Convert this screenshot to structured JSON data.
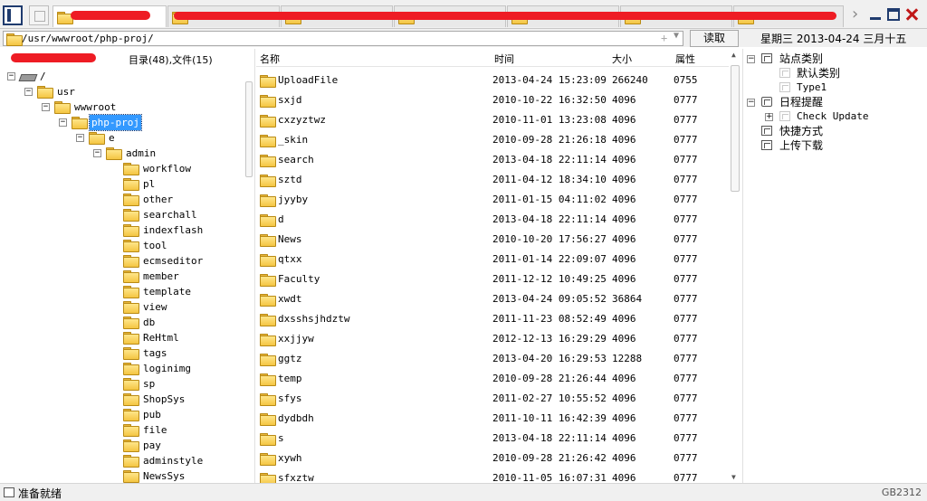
{
  "toolbar": {
    "panel_icon": "sidebar-toggle-icon",
    "home_icon": "window-icon"
  },
  "tabs": [
    {
      "active": true
    },
    {
      "active": false
    },
    {
      "active": false
    },
    {
      "active": false
    },
    {
      "active": false
    },
    {
      "active": false
    },
    {
      "active": false
    }
  ],
  "address": {
    "path": "/usr/wwwroot/php-proj/",
    "add_symbol": "+",
    "dropdown_symbol": "▼",
    "read_label": "读取",
    "date_text": "星期三 2013-04-24 三月十五"
  },
  "tree": {
    "summary": "目录(48),文件(15)",
    "nodes": [
      {
        "label": "/",
        "level": 0,
        "toggle": "−",
        "icon": "drive"
      },
      {
        "label": "usr",
        "level": 1,
        "toggle": "−",
        "icon": "folder"
      },
      {
        "label": "wwwroot",
        "level": 2,
        "toggle": "−",
        "icon": "folder"
      },
      {
        "label": "php-proj",
        "level": 3,
        "toggle": "−",
        "icon": "folder-open",
        "selected": true
      },
      {
        "label": "e",
        "level": 4,
        "toggle": "−",
        "icon": "folder"
      },
      {
        "label": "admin",
        "level": 5,
        "toggle": "−",
        "icon": "folder"
      },
      {
        "label": "workflow",
        "level": 6,
        "icon": "folder"
      },
      {
        "label": "pl",
        "level": 6,
        "icon": "folder"
      },
      {
        "label": "other",
        "level": 6,
        "icon": "folder"
      },
      {
        "label": "searchall",
        "level": 6,
        "icon": "folder"
      },
      {
        "label": "indexflash",
        "level": 6,
        "icon": "folder"
      },
      {
        "label": "tool",
        "level": 6,
        "icon": "folder"
      },
      {
        "label": "ecmseditor",
        "level": 6,
        "icon": "folder"
      },
      {
        "label": "member",
        "level": 6,
        "icon": "folder"
      },
      {
        "label": "template",
        "level": 6,
        "icon": "folder"
      },
      {
        "label": "view",
        "level": 6,
        "icon": "folder"
      },
      {
        "label": "db",
        "level": 6,
        "icon": "folder"
      },
      {
        "label": "ReHtml",
        "level": 6,
        "icon": "folder"
      },
      {
        "label": "tags",
        "level": 6,
        "icon": "folder"
      },
      {
        "label": "loginimg",
        "level": 6,
        "icon": "folder"
      },
      {
        "label": "sp",
        "level": 6,
        "icon": "folder"
      },
      {
        "label": "ShopSys",
        "level": 6,
        "icon": "folder"
      },
      {
        "label": "pub",
        "level": 6,
        "icon": "folder"
      },
      {
        "label": "file",
        "level": 6,
        "icon": "folder"
      },
      {
        "label": "pay",
        "level": 6,
        "icon": "folder"
      },
      {
        "label": "adminstyle",
        "level": 6,
        "icon": "folder"
      },
      {
        "label": "NewsSys",
        "level": 6,
        "icon": "folder"
      }
    ]
  },
  "file_list": {
    "columns": {
      "name": "名称",
      "time": "时间",
      "size": "大小",
      "attr": "属性"
    },
    "rows": [
      {
        "name": "UploadFile",
        "time": "2013-04-24 15:23:09",
        "size": "266240",
        "attr": "0755"
      },
      {
        "name": "sxjd",
        "time": "2010-10-22 16:32:50",
        "size": "4096",
        "attr": "0777"
      },
      {
        "name": "cxzyztwz",
        "time": "2010-11-01 13:23:08",
        "size": "4096",
        "attr": "0777"
      },
      {
        "name": "_skin",
        "time": "2010-09-28 21:26:18",
        "size": "4096",
        "attr": "0777"
      },
      {
        "name": "search",
        "time": "2013-04-18 22:11:14",
        "size": "4096",
        "attr": "0777"
      },
      {
        "name": "sztd",
        "time": "2011-04-12 18:34:10",
        "size": "4096",
        "attr": "0777"
      },
      {
        "name": "jyyby",
        "time": "2011-01-15 04:11:02",
        "size": "4096",
        "attr": "0777"
      },
      {
        "name": "d",
        "time": "2013-04-18 22:11:14",
        "size": "4096",
        "attr": "0777"
      },
      {
        "name": "News",
        "time": "2010-10-20 17:56:27",
        "size": "4096",
        "attr": "0777"
      },
      {
        "name": "qtxx",
        "time": "2011-01-14 22:09:07",
        "size": "4096",
        "attr": "0777"
      },
      {
        "name": "Faculty",
        "time": "2011-12-12 10:49:25",
        "size": "4096",
        "attr": "0777"
      },
      {
        "name": "xwdt",
        "time": "2013-04-24 09:05:52",
        "size": "36864",
        "attr": "0777"
      },
      {
        "name": "dxsshsjhdztw",
        "time": "2011-11-23 08:52:49",
        "size": "4096",
        "attr": "0777"
      },
      {
        "name": "xxjjyw",
        "time": "2012-12-13 16:29:29",
        "size": "4096",
        "attr": "0777"
      },
      {
        "name": "ggtz",
        "time": "2013-04-20 16:29:53",
        "size": "12288",
        "attr": "0777"
      },
      {
        "name": "temp",
        "time": "2010-09-28 21:26:44",
        "size": "4096",
        "attr": "0777"
      },
      {
        "name": "sfys",
        "time": "2011-02-27 10:55:52",
        "size": "4096",
        "attr": "0777"
      },
      {
        "name": "dydbdh",
        "time": "2011-10-11 16:42:39",
        "size": "4096",
        "attr": "0777"
      },
      {
        "name": "s",
        "time": "2013-04-18 22:11:14",
        "size": "4096",
        "attr": "0777"
      },
      {
        "name": "xywh",
        "time": "2010-09-28 21:26:42",
        "size": "4096",
        "attr": "0777"
      },
      {
        "name": "sfxztw",
        "time": "2010-11-05 16:07:31",
        "size": "4096",
        "attr": "0777"
      }
    ]
  },
  "side_panel": {
    "items": [
      {
        "label": "站点类别",
        "level": 0,
        "toggle": "−",
        "icon": "box"
      },
      {
        "label": "默认类别",
        "level": 1,
        "icon": "box-soft"
      },
      {
        "label": "Type1",
        "level": 1,
        "icon": "box-soft",
        "mono": true
      },
      {
        "label": "日程提醒",
        "level": 0,
        "toggle": "−",
        "icon": "clock"
      },
      {
        "label": "Check Update",
        "level": 1,
        "toggle": "+",
        "icon": "box-soft",
        "mono": true
      },
      {
        "label": "快捷方式",
        "level": 0,
        "icon": "box"
      },
      {
        "label": "上传下载",
        "level": 0,
        "icon": "box"
      }
    ]
  },
  "status": {
    "text": "准备就绪",
    "encoding": "GB2312"
  },
  "colors": {
    "selection": "#3399ff",
    "redaction": "#ee1c24",
    "folder": "#f4c542"
  }
}
